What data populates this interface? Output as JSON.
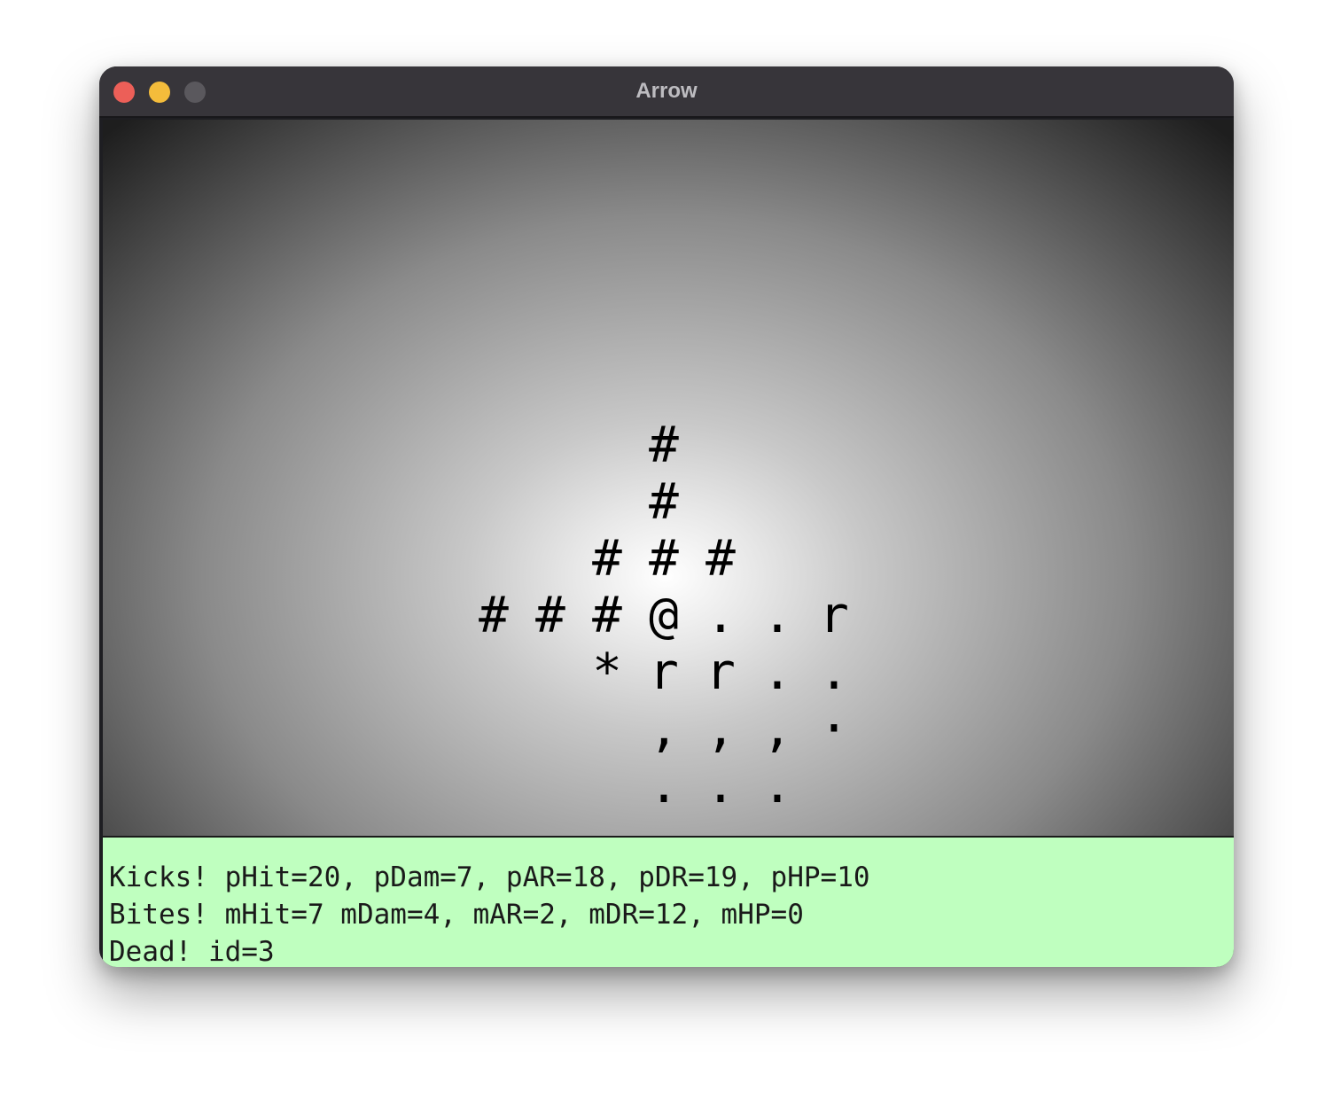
{
  "window": {
    "title": "Arrow"
  },
  "colors": {
    "log_background": "#bfffbf",
    "titlebar": "#37353a",
    "close": "#ec5f58",
    "minimize": "#f4bc3b",
    "maximize": "#5a585d"
  },
  "map": {
    "rows": [
      [
        "",
        "",
        "",
        "#",
        "",
        "",
        ""
      ],
      [
        "",
        "",
        "",
        "#",
        "",
        "",
        ""
      ],
      [
        "",
        "",
        "#",
        "#",
        "#",
        "",
        ""
      ],
      [
        "#",
        "#",
        "#",
        "@",
        ".",
        ".",
        "r"
      ],
      [
        "",
        "",
        "*",
        "r",
        "r",
        ".",
        "."
      ],
      [
        "",
        "",
        "",
        ",",
        ",",
        ",",
        "·"
      ],
      [
        "",
        "",
        "",
        ".",
        ".",
        ".",
        ""
      ]
    ]
  },
  "log": {
    "lines": [
      "Kicks! pHit=20, pDam=7, pAR=18, pDR=19, pHP=10",
      "Bites! mHit=7 mDam=4, mAR=2, mDR=12, mHP=0",
      "Dead! id=3"
    ]
  }
}
